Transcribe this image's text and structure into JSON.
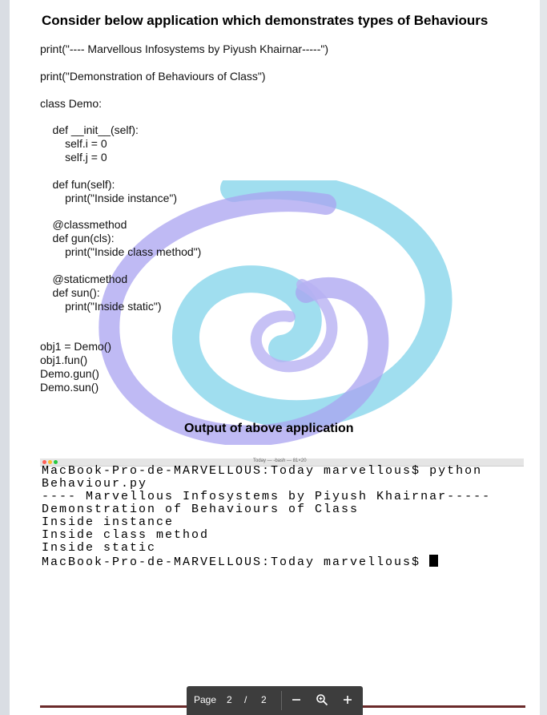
{
  "document": {
    "title": "Consider below application which demonstrates types of Behaviours",
    "code_lines": [
      "print(\"---- Marvellous Infosystems by Piyush Khairnar-----\")",
      "print(\"Demonstration of Behaviours of Class\")",
      "class Demo:",
      "    def __init__(self):",
      "        self.i = 0",
      "        self.j = 0",
      "    def fun(self):",
      "        print(\"Inside instance\")",
      "    @classmethod",
      "    def gun(cls):",
      "        print(\"Inside class method\")",
      "    @staticmethod",
      "    def sun():",
      "        print(\"Inside static\")",
      "obj1 = Demo()",
      "obj1.fun()",
      "Demo.gun()",
      "Demo.sun()"
    ],
    "output_title": "Output of above application"
  },
  "terminal": {
    "window_caption": "Today — -bash — 81×20",
    "lines": [
      "MacBook-Pro-de-MARVELLOUS:Today marvellous$ python",
      "Behaviour.py",
      "---- Marvellous Infosystems by Piyush Khairnar-----",
      "Demonstration of Behaviours of Class",
      "Inside instance",
      "Inside class method",
      "Inside static",
      "MacBook-Pro-de-MARVELLOUS:Today marvellous$ "
    ]
  },
  "toolbar": {
    "page_label": "Page",
    "current_page": "2",
    "separator": "/",
    "total_pages": "2",
    "zoom_out_icon": "minus-icon",
    "zoom_icon": "magnifier-icon",
    "zoom_in_icon": "plus-icon"
  },
  "colors": {
    "swirl_blue": "#8fd8ec",
    "swirl_purple": "#a9a3f0",
    "toolbar_bg": "#3d3d3d",
    "footer_line": "#6b2a2a"
  }
}
